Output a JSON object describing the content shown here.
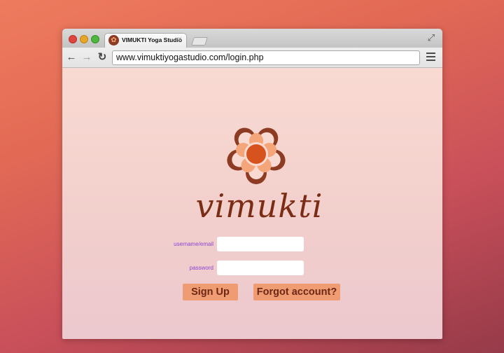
{
  "browser": {
    "tab_title": "VIMUKTI Yoga Studio",
    "tab_close": "×",
    "url": "www.vimuktiyogastudio.com/login.php",
    "icons": {
      "back": "arrow-left-icon",
      "forward": "arrow-right-icon",
      "reload": "reload-icon",
      "menu": "hamburger-menu-icon",
      "fullscreen": "fullscreen-icon",
      "favicon": "flower-logo-icon"
    }
  },
  "page": {
    "brand_name": "vimukti",
    "username_label": "username/email",
    "username_value": "",
    "password_label": "password",
    "password_value": "",
    "signup_label": "Sign Up",
    "forgot_label": "Forgot account?"
  },
  "colors": {
    "brand": "#7b2c14",
    "button": "#ef9c72",
    "label": "#8a45d0",
    "petal_dark": "#8e3b23",
    "petal_light": "#f4a67a",
    "center": "#d6531d"
  }
}
